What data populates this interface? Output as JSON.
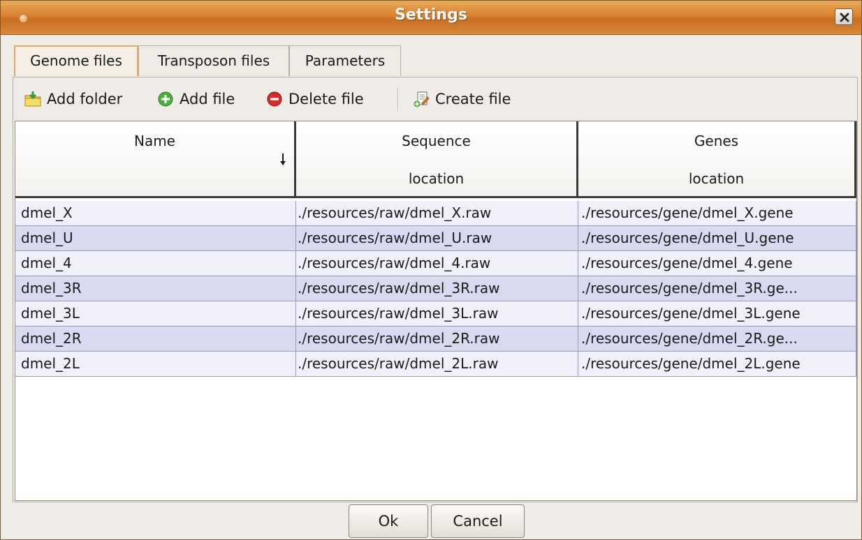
{
  "window": {
    "title": "Settings"
  },
  "tabs": [
    {
      "label": "Genome files",
      "active": true
    },
    {
      "label": "Transposon files",
      "active": false
    },
    {
      "label": "Parameters",
      "active": false
    }
  ],
  "toolbar": {
    "add_folder": "Add folder",
    "add_file": "Add file",
    "delete_file": "Delete file",
    "create_file": "Create file"
  },
  "table": {
    "columns": [
      {
        "line1": "Name",
        "line2": ""
      },
      {
        "line1": "Sequence",
        "line2": "location"
      },
      {
        "line1": "Genes",
        "line2": "location"
      }
    ],
    "sort_column": "Name",
    "sort_direction": "descending",
    "rows": [
      [
        "dmel_X",
        "./resources/raw/dmel_X.raw",
        "./resources/gene/dmel_X.gene"
      ],
      [
        "dmel_U",
        "./resources/raw/dmel_U.raw",
        "./resources/gene/dmel_U.gene"
      ],
      [
        "dmel_4",
        "./resources/raw/dmel_4.raw",
        "./resources/gene/dmel_4.gene"
      ],
      [
        "dmel_3R",
        "./resources/raw/dmel_3R.raw",
        "./resources/gene/dmel_3R.ge..."
      ],
      [
        "dmel_3L",
        "./resources/raw/dmel_3L.raw",
        "./resources/gene/dmel_3L.gene"
      ],
      [
        "dmel_2R",
        "./resources/raw/dmel_2R.raw",
        "./resources/gene/dmel_2R.ge..."
      ],
      [
        "dmel_2L",
        "./resources/raw/dmel_2L.raw",
        "./resources/gene/dmel_2L.gene"
      ]
    ]
  },
  "buttons": {
    "ok": "Ok",
    "cancel": "Cancel"
  },
  "colors": {
    "titlebar": "#d9822e",
    "row_odd": "#f0f0fa",
    "row_even": "#d9d9f0",
    "active_tab_border": "#e8a85c"
  }
}
